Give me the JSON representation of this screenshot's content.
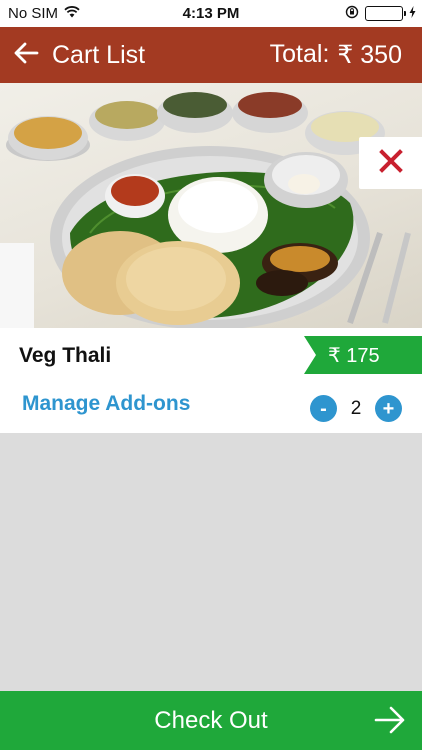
{
  "status_bar": {
    "carrier": "No SIM",
    "time": "4:13 PM"
  },
  "header": {
    "title": "Cart List",
    "total_label": "Total:",
    "total_value": "₹ 350"
  },
  "cart_item": {
    "name": "Veg Thali",
    "price": "₹ 175",
    "manage_addons_label": "Manage Add-ons",
    "quantity": "2",
    "decrement_label": "-",
    "increment_label": "+"
  },
  "checkout": {
    "label": "Check Out"
  },
  "colors": {
    "header_bg": "#a33a22",
    "accent_green": "#1fa83a",
    "accent_blue": "#2e95cf",
    "remove_red": "#c8202f"
  },
  "icons": {
    "back": "arrow-left-icon",
    "remove": "close-icon",
    "checkout": "arrow-right-icon",
    "wifi": "wifi-icon",
    "battery": "battery-icon",
    "orientation_lock": "orientation-lock-icon"
  }
}
